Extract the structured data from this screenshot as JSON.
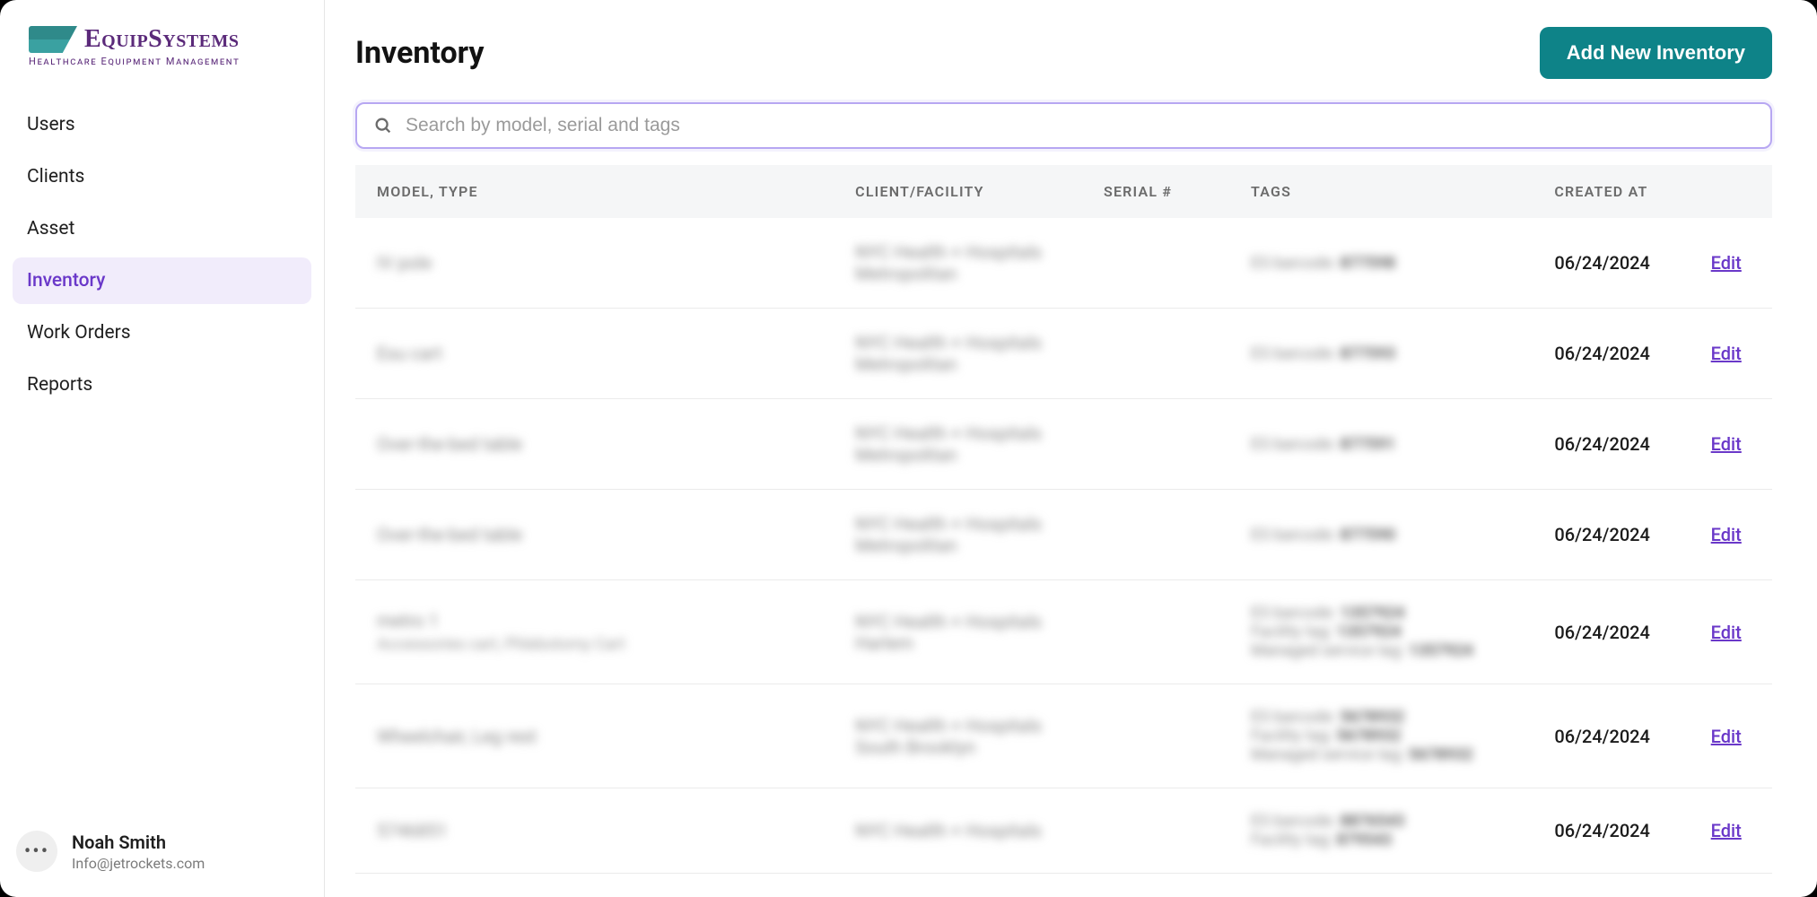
{
  "brand": {
    "name": "EquipSystems",
    "tagline": "Healthcare Equipment Management"
  },
  "sidebar": {
    "items": [
      {
        "label": "Users",
        "active": false
      },
      {
        "label": "Clients",
        "active": false
      },
      {
        "label": "Asset",
        "active": false
      },
      {
        "label": "Inventory",
        "active": true
      },
      {
        "label": "Work Orders",
        "active": false
      },
      {
        "label": "Reports",
        "active": false
      }
    ]
  },
  "user": {
    "name": "Noah Smith",
    "email": "Info@jetrockets.com",
    "avatar_glyph": "•••"
  },
  "header": {
    "title": "Inventory",
    "primary_button": "Add New Inventory"
  },
  "search": {
    "placeholder": "Search by model, serial and tags",
    "value": ""
  },
  "table": {
    "columns": {
      "model": "MODEL, TYPE",
      "client": "CLIENT/FACILITY",
      "serial": "SERIAL #",
      "tags": "TAGS",
      "created": "CREATED AT"
    },
    "edit_label": "Edit",
    "rows": [
      {
        "model": "IV pole",
        "model_sub": "",
        "client": "NYC Health + Hospitals Metropolitan",
        "serial": "",
        "tags": [
          {
            "k": "ES barcode",
            "v": "877598"
          }
        ],
        "created": "06/24/2024"
      },
      {
        "model": "Esu cart",
        "model_sub": "",
        "client": "NYC Health + Hospitals Metropolitan",
        "serial": "",
        "tags": [
          {
            "k": "ES barcode",
            "v": "877593"
          }
        ],
        "created": "06/24/2024"
      },
      {
        "model": "Over-the-bed table",
        "model_sub": "",
        "client": "NYC Health + Hospitals Metropolitan",
        "serial": "",
        "tags": [
          {
            "k": "ES barcode",
            "v": "877591"
          }
        ],
        "created": "06/24/2024"
      },
      {
        "model": "Over-the-bed table",
        "model_sub": "",
        "client": "NYC Health + Hospitals Metropolitan",
        "serial": "",
        "tags": [
          {
            "k": "ES barcode",
            "v": "877590"
          }
        ],
        "created": "06/24/2024"
      },
      {
        "model": "metro 1",
        "model_sub": "Accessories cart, Phlebotomy Cart",
        "client": "NYC Health + Hospitals Harlem",
        "serial": "",
        "tags": [
          {
            "k": "ES barcode",
            "v": "1357924"
          },
          {
            "k": "Facility tag",
            "v": "1357924"
          },
          {
            "k": "Managed service tag",
            "v": "1357924"
          }
        ],
        "created": "06/24/2024"
      },
      {
        "model": "Wheelchair, Leg rest",
        "model_sub": "",
        "client": "NYC Health + Hospitals South Brooklyn",
        "serial": "",
        "tags": [
          {
            "k": "ES barcode",
            "v": "5678932"
          },
          {
            "k": "Facility tag",
            "v": "5678932"
          },
          {
            "k": "Managed service tag",
            "v": "5678932"
          }
        ],
        "created": "06/24/2024"
      },
      {
        "model": "5746851",
        "model_sub": "",
        "client": "NYC Health + Hospitals",
        "serial": "",
        "tags": [
          {
            "k": "ES barcode",
            "v": "8876543"
          },
          {
            "k": "Facility tag",
            "v": "879543"
          }
        ],
        "created": "06/24/2024"
      }
    ]
  }
}
